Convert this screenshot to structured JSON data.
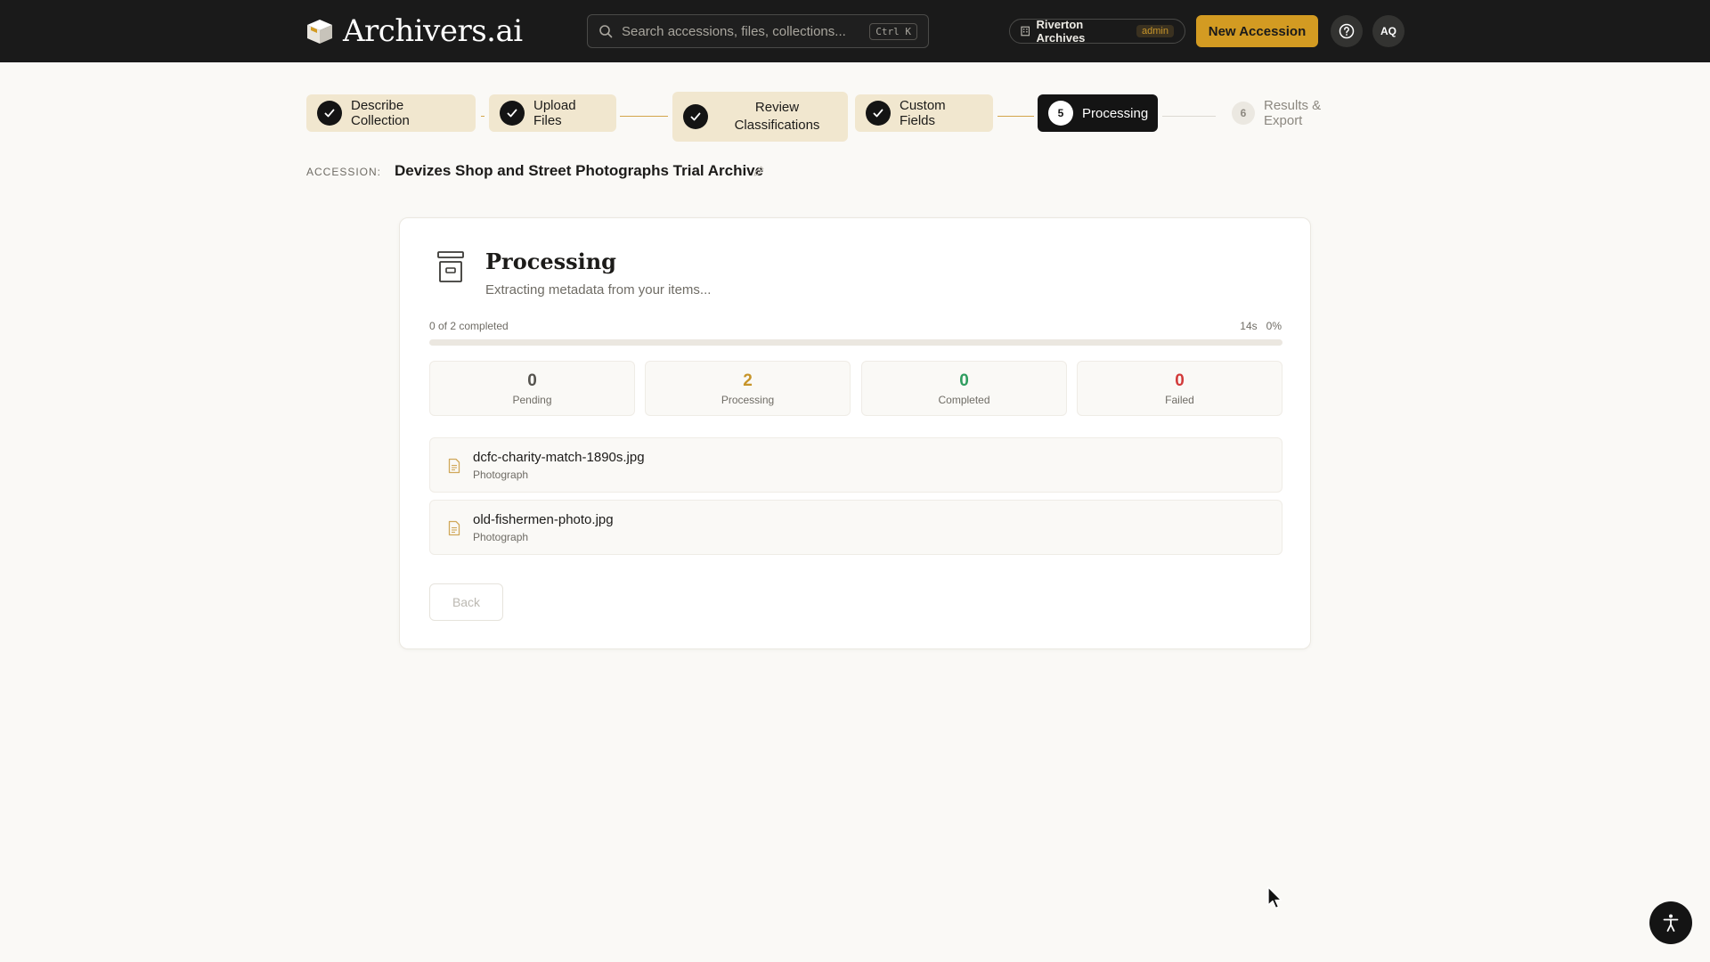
{
  "header": {
    "brand": "Archivers.ai",
    "search_placeholder": "Search accessions, files, collections...",
    "search_shortcut": "Ctrl K",
    "org_name": "Riverton Archives",
    "org_role": "admin",
    "new_button": "New Accession",
    "avatar_initials": "AQ"
  },
  "stepper": {
    "steps": [
      {
        "label": "Describe Collection",
        "state": "done"
      },
      {
        "label": "Upload Files",
        "state": "done"
      },
      {
        "label_line1": "Review",
        "label_line2": "Classifications",
        "state": "done"
      },
      {
        "label": "Custom Fields",
        "state": "done"
      },
      {
        "number": "5",
        "label": "Processing",
        "state": "active"
      },
      {
        "number": "6",
        "label": "Results & Export",
        "state": "todo"
      }
    ]
  },
  "accession": {
    "label": "ACCESSION:",
    "title": "Devizes Shop and Street Photographs Trial Archive"
  },
  "processing": {
    "title": "Processing",
    "subtitle": "Extracting metadata from your items...",
    "progress_text": "0 of 2 completed",
    "elapsed": "14s",
    "percent_text": "0%",
    "progress_fraction": 0,
    "stats": [
      {
        "value": "0",
        "label": "Pending",
        "color": "#55534e"
      },
      {
        "value": "2",
        "label": "Processing",
        "color": "#c7952a"
      },
      {
        "value": "0",
        "label": "Completed",
        "color": "#2f9d5f"
      },
      {
        "value": "0",
        "label": "Failed",
        "color": "#d23a3a"
      }
    ],
    "files": [
      {
        "name": "dcfc-charity-match-1890s.jpg",
        "type": "Photograph"
      },
      {
        "name": "old-fishermen-photo.jpg",
        "type": "Photograph"
      }
    ],
    "back_button": "Back"
  },
  "colors": {
    "accent": "#d39b22",
    "topbar": "#1a1a1a",
    "step_done_bg": "#f1e7cf"
  }
}
